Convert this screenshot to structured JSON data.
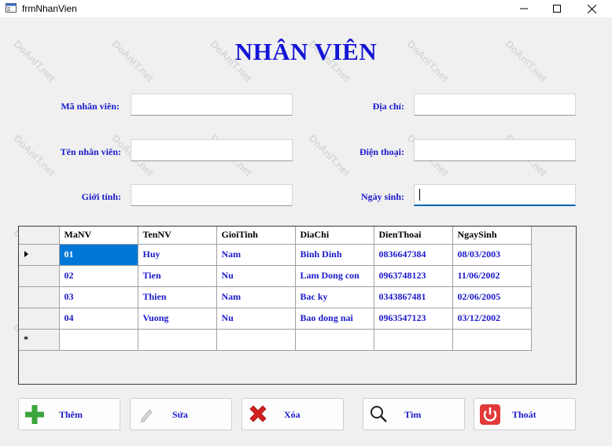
{
  "window": {
    "title": "frmNhanVien",
    "controls": {
      "minimize": "minimize",
      "maximize": "maximize",
      "close": "close"
    }
  },
  "form": {
    "title": "NHÂN VIÊN",
    "fields": {
      "ma_nv": {
        "label": "Mã nhân viên:",
        "value": ""
      },
      "ten_nv": {
        "label": "Tên nhân viên:",
        "value": ""
      },
      "gioi_tinh": {
        "label": "Giới tính:",
        "value": ""
      },
      "dia_chi": {
        "label": "Địa chỉ:",
        "value": ""
      },
      "dien_thoai": {
        "label": "Điện thoại:",
        "value": ""
      },
      "ngay_sinh": {
        "label": "Ngày sinh:",
        "value": ""
      }
    }
  },
  "grid": {
    "columns": [
      "MaNV",
      "TenNV",
      "GioiTinh",
      "DiaChi",
      "DienThoai",
      "NgaySinh"
    ],
    "rows": [
      [
        "01",
        "Huy",
        "Nam",
        "Binh Dinh",
        "0836647384",
        "08/03/2003"
      ],
      [
        "02",
        "Tien",
        "Nu",
        "Lam Dong con",
        "0963748123",
        "11/06/2002"
      ],
      [
        "03",
        "Thien",
        "Nam",
        "Bac ky",
        "0343867481",
        "02/06/2005"
      ],
      [
        "04",
        "Vuong",
        "Nu",
        "Bao dong nai",
        "0963547123",
        "03/12/2002"
      ]
    ],
    "new_row_marker": "*"
  },
  "buttons": {
    "them": "Thêm",
    "sua": "Sửa",
    "xoa": "Xóa",
    "tim": "Tìm",
    "thoat": "Thoát"
  },
  "watermark": "DoAnIT.net",
  "colors": {
    "label": "#1a1acc",
    "title": "#1414d6",
    "selection": "#0078d7"
  }
}
